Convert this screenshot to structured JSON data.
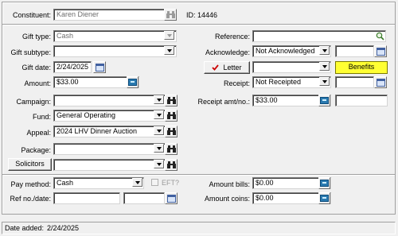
{
  "header": {
    "constituent_label": "Constituent:",
    "constituent_value": "Karen Diener",
    "id_label": "ID:",
    "id_value": "14446"
  },
  "left": {
    "gift_type_label": "Gift type:",
    "gift_type_value": "Cash",
    "gift_subtype_label": "Gift subtype:",
    "gift_subtype_value": "",
    "gift_date_label": "Gift date:",
    "gift_date_value": "2/24/2025",
    "amount_label": "Amount:",
    "amount_value": "$33.00",
    "campaign_label": "Campaign:",
    "campaign_value": "",
    "fund_label": "Fund:",
    "fund_value": "General Operating",
    "appeal_label": "Appeal:",
    "appeal_value": "2024 LHV Dinner Auction",
    "package_label": "Package:",
    "package_value": "",
    "solicitors_button": "Solicitors",
    "solicitors_value": ""
  },
  "right": {
    "reference_label": "Reference:",
    "reference_value": "",
    "acknowledge_label": "Acknowledge:",
    "acknowledge_value": "Not Acknowledged",
    "acknowledge_date": "",
    "letter_button": "Letter",
    "letter_value": "",
    "benefits_button": "Benefits",
    "receipt_label": "Receipt:",
    "receipt_value": "Not Receipted",
    "receipt_date": "",
    "receipt_amt_label": "Receipt amt/no.:",
    "receipt_amt_value": "$33.00",
    "receipt_no_value": ""
  },
  "payment": {
    "pay_method_label": "Pay method:",
    "pay_method_value": "Cash",
    "eft_label": "EFT?",
    "ref_no_label": "Ref no./date:",
    "ref_no_value": "",
    "ref_date_value": "",
    "amount_bills_label": "Amount bills:",
    "amount_bills_value": "$0.00",
    "amount_coins_label": "Amount coins:",
    "amount_coins_value": "$0.00"
  },
  "footer": {
    "date_added_label": "Date added:",
    "date_added_value": "2/24/2025"
  },
  "colors": {
    "window_bg": "#f0f0f0",
    "benefits_bg": "#ffff33",
    "check_red": "#cc0000"
  },
  "icons": [
    "binoculars-icon",
    "calendar-icon",
    "calculator-icon",
    "search-icon",
    "checkmark-icon",
    "chevron-down-icon"
  ]
}
